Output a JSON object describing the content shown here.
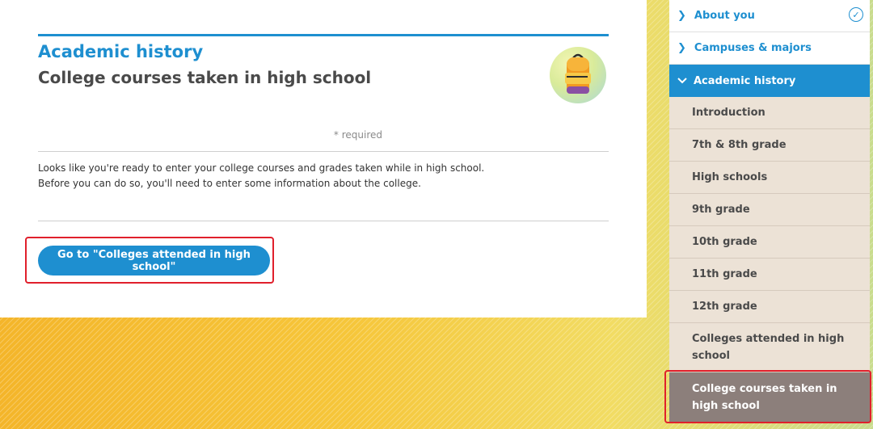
{
  "main": {
    "section_title": "Academic history",
    "page_title": "College courses taken in high school",
    "required_note": "* required",
    "body_lines": [
      "Looks like you're ready to enter your college courses and grades taken while in high school.",
      "Before you can do so, you'll need to enter some information about the college."
    ],
    "go_button_label": "Go to \"Colleges attended in high school\"",
    "illustration_icon": "backpack-icon"
  },
  "sidebar": {
    "top_items": [
      {
        "label": "About you",
        "icon": "chevron-right-icon",
        "completed": true
      },
      {
        "label": "Campuses & majors",
        "icon": "chevron-right-icon",
        "completed": false
      }
    ],
    "active_section": {
      "label": "Academic history",
      "icon": "chevron-down-icon"
    },
    "sub_items": [
      "Introduction",
      "7th & 8th grade",
      "High schools",
      "9th grade",
      "10th grade",
      "11th grade",
      "12th grade",
      "Colleges attended in high school"
    ],
    "current_item": "College courses taken in high school"
  },
  "colors": {
    "accent": "#1e8fd0",
    "highlight": "#e0202c",
    "current_item_bg": "#8c7f7b",
    "sub_item_bg": "#ece2d6"
  }
}
